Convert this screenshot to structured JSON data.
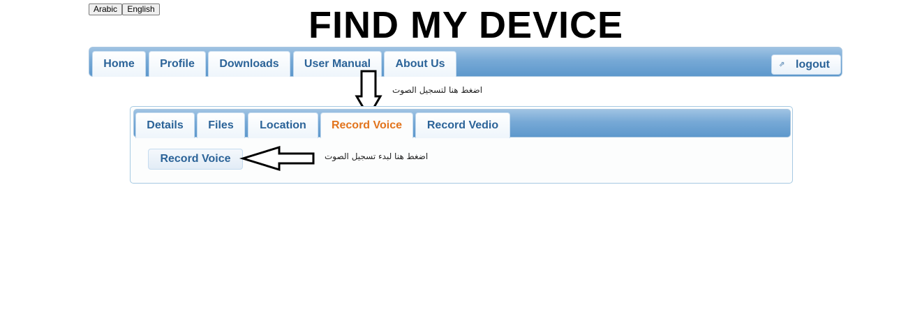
{
  "lang": {
    "arabic": "Arabic",
    "english": "English"
  },
  "title": "FIND MY DEVICE",
  "topnav": {
    "tabs": [
      "Home",
      "Profile",
      "Downloads",
      "User Manual",
      "About Us"
    ],
    "logout": "logout"
  },
  "hints": {
    "record_tab": "اضغط هنا لتسجيل الصوت",
    "record_button": "اضغط هنا لبدء تسجيل الصوت"
  },
  "subnav": {
    "tabs": [
      "Details",
      "Files",
      "Location",
      "Record Voice",
      "Record Vedio"
    ],
    "active": "Record Voice"
  },
  "record_button": "Record Voice",
  "colors": {
    "nav_gradient_top": "#9fc3e3",
    "nav_gradient_bottom": "#5d98cc",
    "tab_text": "#2b6398",
    "active_tab_text": "#e2741d"
  },
  "icons": {
    "logout": "external-link-icon",
    "down_arrow": "arrow-down-icon",
    "left_arrow": "arrow-left-icon"
  }
}
